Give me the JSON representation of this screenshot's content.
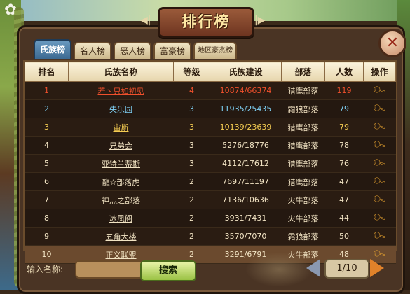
{
  "window": {
    "title": "排行榜"
  },
  "close_glyph": "✕",
  "tabs": [
    {
      "label": "氏族榜",
      "active": true
    },
    {
      "label": "名人榜"
    },
    {
      "label": "恶人榜"
    },
    {
      "label": "富豪榜"
    },
    {
      "label": "地区豪杰榜"
    }
  ],
  "table": {
    "headers": {
      "rank": "排名",
      "name": "氏族名称",
      "level": "等级",
      "build": "氏族建设",
      "tribe": "部落",
      "count": "人数",
      "op": "操作"
    },
    "rows": [
      {
        "rank": "1",
        "name": "若丶只如初见",
        "level": "4",
        "build": "10874/66374",
        "tribe": "猎鹰部落",
        "count": "119"
      },
      {
        "rank": "2",
        "name": "失乐园",
        "level": "3",
        "build": "11935/25435",
        "tribe": "霜狼部落",
        "count": "79"
      },
      {
        "rank": "3",
        "name": "宙斯",
        "level": "3",
        "build": "10139/23639",
        "tribe": "猎鹰部落",
        "count": "79"
      },
      {
        "rank": "4",
        "name": "兄弟会",
        "level": "3",
        "build": "5276/18776",
        "tribe": "猎鹰部落",
        "count": "78"
      },
      {
        "rank": "5",
        "name": "亚特兰蒂斯",
        "level": "3",
        "build": "4112/17612",
        "tribe": "猎鹰部落",
        "count": "76"
      },
      {
        "rank": "6",
        "name": "龍☆部落虎",
        "level": "2",
        "build": "7697/11197",
        "tribe": "猎鹰部落",
        "count": "47"
      },
      {
        "rank": "7",
        "name": "神灬之部落",
        "level": "2",
        "build": "7136/10636",
        "tribe": "火牛部落",
        "count": "47"
      },
      {
        "rank": "8",
        "name": "冰凤阁",
        "level": "2",
        "build": "3931/7431",
        "tribe": "火牛部落",
        "count": "44"
      },
      {
        "rank": "9",
        "name": "五角大楼",
        "level": "2",
        "build": "3570/7070",
        "tribe": "霜狼部落",
        "count": "50"
      },
      {
        "rank": "10",
        "name": "正义联盟",
        "level": "2",
        "build": "3291/6791",
        "tribe": "火牛部落",
        "count": "48"
      }
    ],
    "op_icon": "search-icon"
  },
  "search": {
    "label": "输入名称:",
    "value": "",
    "button": "搜索"
  },
  "pager": {
    "text": "1/10"
  },
  "colors": {
    "rank1": "#f0502c",
    "rank2": "#7fd0f4",
    "rank3": "#f4cc52",
    "active_tab": "#3c6a92"
  }
}
